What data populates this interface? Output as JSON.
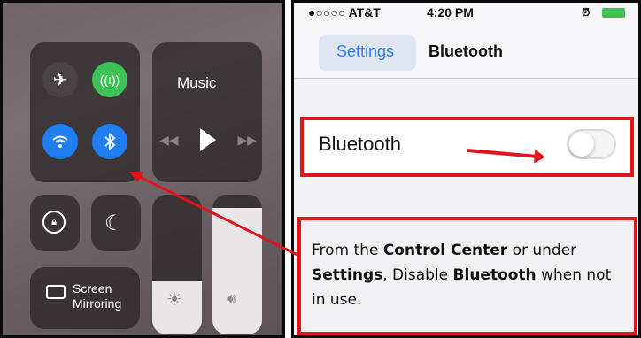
{
  "control_center": {
    "music_label": "Music",
    "screen_mirroring_line1": "Screen",
    "screen_mirroring_line2": "Mirroring"
  },
  "settings": {
    "status_bar": {
      "carrier": "●○○○○ AT&T",
      "time": "4:20 PM"
    },
    "nav": {
      "back_label": "Settings",
      "title": "Bluetooth"
    },
    "bluetooth_row": {
      "label": "Bluetooth",
      "toggle_state": "off"
    }
  },
  "info": {
    "part1": "From the ",
    "bold1": "Control Center",
    "part2": " or under ",
    "bold2": "Settings",
    "part3": ", Disable ",
    "bold3": "Bluetooth",
    "part4": " when not in use."
  },
  "colors": {
    "accent_blue": "#1f7ff2",
    "accent_green": "#3fc255",
    "highlight_red": "#e0151b"
  }
}
